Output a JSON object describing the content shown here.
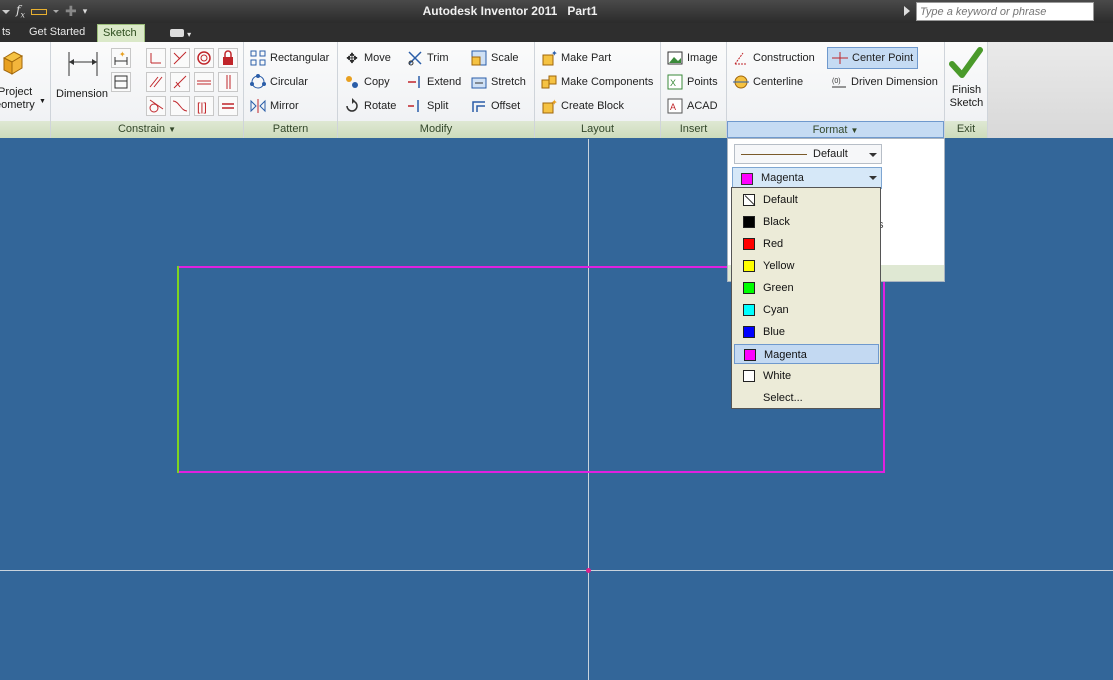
{
  "window": {
    "app_title": "Autodesk Inventor 2011",
    "doc_title": "Part1",
    "search_placeholder": "Type a keyword or phrase"
  },
  "tabs": [
    {
      "label": "ts"
    },
    {
      "label": "Get Started"
    },
    {
      "label": "Sketch"
    }
  ],
  "ribbon": {
    "draw": {
      "project_geometry_line1": "Project",
      "project_geometry_line2": "eometry"
    },
    "constrain": {
      "dimension_label": "Dimension",
      "panel_label": "Constrain"
    },
    "pattern": {
      "rectangular": "Rectangular",
      "circular": "Circular",
      "mirror": "Mirror",
      "panel_label": "Pattern"
    },
    "modify": {
      "move": "Move",
      "copy": "Copy",
      "rotate": "Rotate",
      "trim": "Trim",
      "extend": "Extend",
      "split": "Split",
      "scale": "Scale",
      "stretch": "Stretch",
      "offset": "Offset",
      "panel_label": "Modify"
    },
    "layout": {
      "make_part": "Make Part",
      "make_components": "Make Components",
      "create_block": "Create Block",
      "panel_label": "Layout"
    },
    "insert": {
      "image": "Image",
      "points": "Points",
      "acad": "ACAD",
      "panel_label": "Insert"
    },
    "format": {
      "construction": "Construction",
      "centerline": "Centerline",
      "center_point": "Center Point",
      "driven_dimension": "Driven Dimension",
      "panel_label": "Format"
    },
    "exit": {
      "finish_line1": "Finish",
      "finish_line2": "Sketch",
      "panel_label": "Exit"
    }
  },
  "format_dropdown": {
    "linetype_value": "Default",
    "color_value": "Magenta",
    "color_value_hex": "#ff00ff",
    "clipped_text": "s"
  },
  "color_list": [
    {
      "label": "Default",
      "hex": "#ffffff"
    },
    {
      "label": "Black",
      "hex": "#000000"
    },
    {
      "label": "Red",
      "hex": "#ff0000"
    },
    {
      "label": "Yellow",
      "hex": "#ffff00"
    },
    {
      "label": "Green",
      "hex": "#00ff00"
    },
    {
      "label": "Cyan",
      "hex": "#00ffff"
    },
    {
      "label": "Blue",
      "hex": "#0000ff"
    },
    {
      "label": "Magenta",
      "hex": "#ff00ff",
      "selected": true
    },
    {
      "label": "White",
      "hex": "#ffffff"
    },
    {
      "label": "Select...",
      "hex": ""
    }
  ],
  "colors": {
    "canvas_bg": "#336699",
    "sketch_line": "#e020e0",
    "fixed_line": "#7ed321"
  }
}
